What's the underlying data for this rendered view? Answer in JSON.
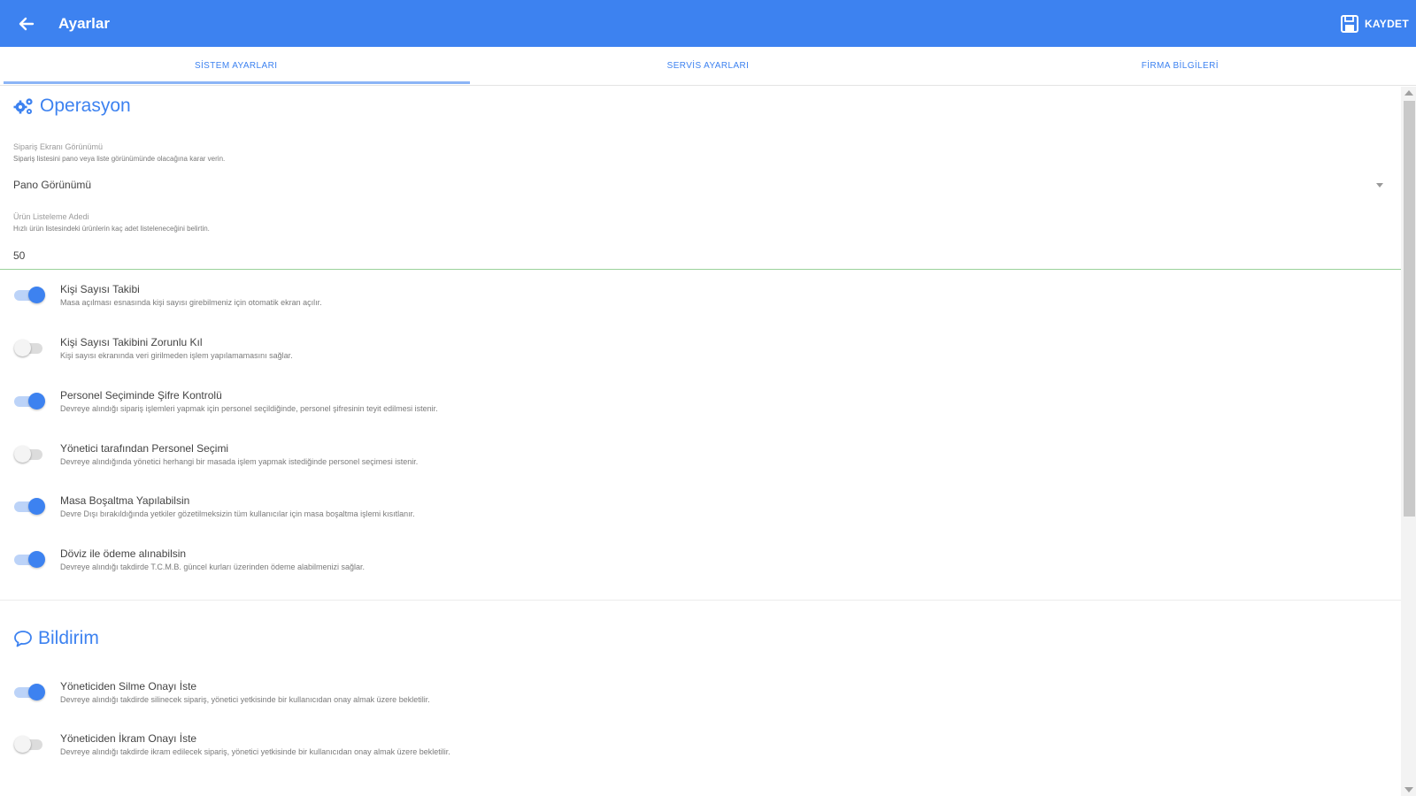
{
  "header": {
    "title": "Ayarlar",
    "save_label": "KAYDET",
    "colors": {
      "appbar": "#3d82f0",
      "accent": "#3d82f0"
    }
  },
  "tabs": [
    {
      "label": "SİSTEM AYARLARI",
      "active": true
    },
    {
      "label": "SERVİS AYARLARI",
      "active": false
    },
    {
      "label": "FİRMA BİLGİLERİ",
      "active": false
    }
  ],
  "operasyon": {
    "title": "Operasyon",
    "icon": "gears-icon",
    "order_screen": {
      "label": "Sipariş Ekranı Görünümü",
      "hint": "Sipariş listesini pano veya liste görünümünde olacağına karar verin.",
      "value": "Pano Görünümü"
    },
    "product_count": {
      "label": "Ürün Listeleme Adedi",
      "hint": "Hızlı ürün listesindeki ürünlerin kaç adet listeleneceğini belirtin.",
      "value": "50"
    },
    "toggles": [
      {
        "title": "Kişi Sayısı Takibi",
        "desc": "Masa açılması esnasında kişi sayısı girebilmeniz için otomatik ekran açılır.",
        "on": true
      },
      {
        "title": "Kişi Sayısı Takibini Zorunlu Kıl",
        "desc": "Kişi sayısı ekranında veri girilmeden işlem yapılamamasını sağlar.",
        "on": false
      },
      {
        "title": "Personel Seçiminde Şifre Kontrolü",
        "desc": "Devreye alındığı sipariş işlemleri yapmak için personel seçildiğinde, personel şifresinin teyit edilmesi istenir.",
        "on": true
      },
      {
        "title": "Yönetici tarafından Personel Seçimi",
        "desc": "Devreye alındığında yönetici herhangi bir masada işlem yapmak istediğinde personel seçimesi istenir.",
        "on": false
      },
      {
        "title": "Masa Boşaltma Yapılabilsin",
        "desc": "Devre Dışı bırakıldığında yetkiler gözetilmeksizin tüm kullanıcılar için masa boşaltma işlemi kısıtlanır.",
        "on": true
      },
      {
        "title": "Döviz ile ödeme alınabilsin",
        "desc": "Devreye alındığı takdirde T.C.M.B. güncel kurları üzerinden ödeme alabilmenizi sağlar.",
        "on": true
      }
    ]
  },
  "bildirim": {
    "title": "Bildirim",
    "icon": "speech-bubble-icon",
    "toggles": [
      {
        "title": "Yöneticiden Silme Onayı İste",
        "desc": "Devreye alındığı takdirde silinecek sipariş, yönetici yetkisinde bir kullanıcıdan onay almak üzere bekletilir.",
        "on": true
      },
      {
        "title": "Yöneticiden İkram Onayı İste",
        "desc": "Devreye alındığı takdirde ikram edilecek sipariş, yönetici yetkisinde bir kullanıcıdan onay almak üzere bekletilir.",
        "on": false
      }
    ]
  }
}
